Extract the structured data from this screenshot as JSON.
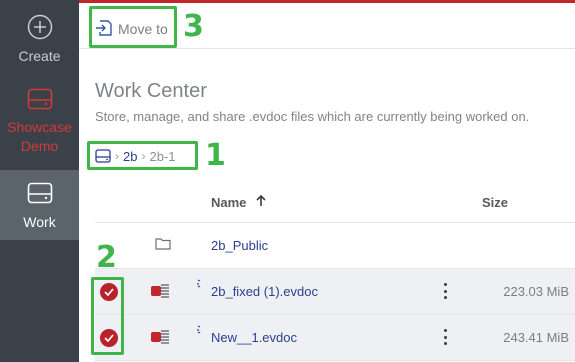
{
  "sidebar": {
    "items": [
      {
        "label": "Create",
        "icon": "plus-circle-icon"
      },
      {
        "label": "Showcase\nDemo",
        "icon": "drive-icon"
      },
      {
        "label": "Work",
        "icon": "drive-icon"
      }
    ]
  },
  "toolbar": {
    "move_label": "Move to",
    "move_icon": "move-to-icon"
  },
  "header": {
    "title": "Work Center",
    "subtitle": "Store, manage, and share .evdoc files which are currently being worked on."
  },
  "breadcrumb": {
    "root_icon": "drive-icon",
    "items": [
      "2b",
      "2b-1"
    ]
  },
  "table": {
    "columns": {
      "name": "Name",
      "size": "Size",
      "sort_icon": "arrow-up-icon"
    },
    "rows": [
      {
        "name": "2b_Public",
        "size": "",
        "type": "folder",
        "selected": false
      },
      {
        "name": "2b_fixed (1).evdoc",
        "size": "223.03 MiB",
        "type": "evdoc",
        "selected": true
      },
      {
        "name": "New__1.evdoc",
        "size": "243.41 MiB",
        "type": "evdoc",
        "selected": true
      }
    ]
  },
  "annotations": [
    "1",
    "2",
    "3"
  ],
  "colors": {
    "rail": "#3a4148",
    "accent_red": "#c0272d",
    "highlight_green": "#3fb54a",
    "link_blue": "#2a3f8f"
  }
}
